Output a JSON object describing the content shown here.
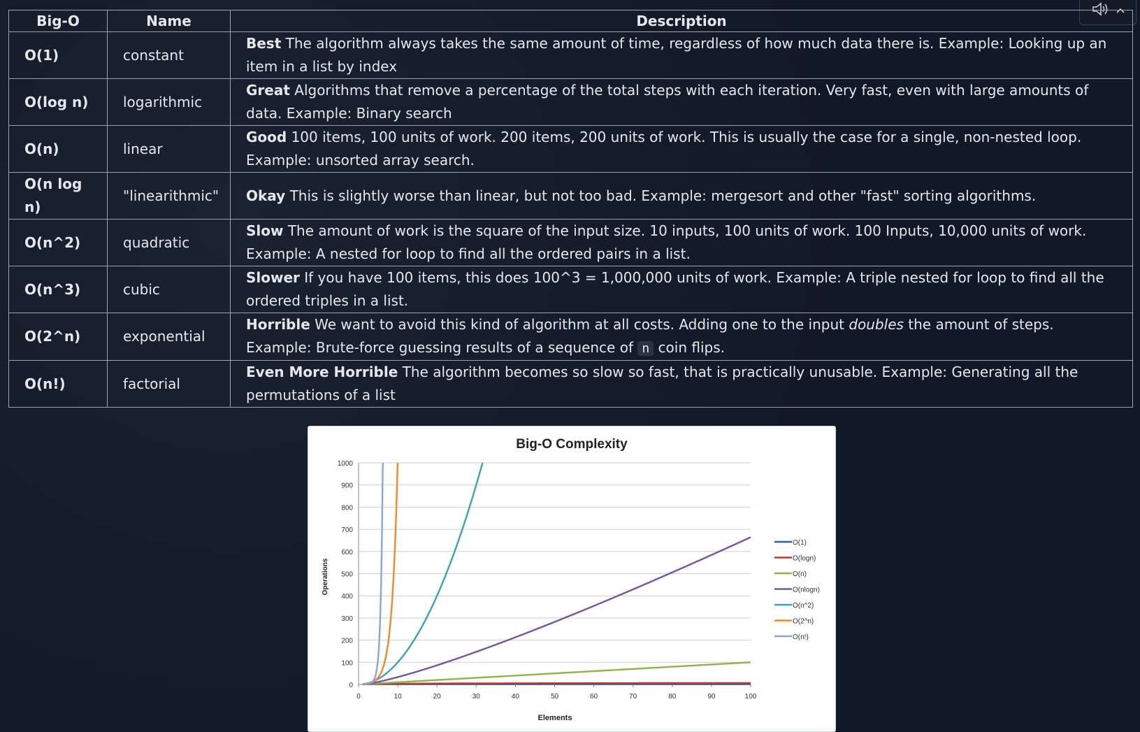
{
  "table": {
    "headers": [
      "Big-O",
      "Name",
      "Description"
    ],
    "rows": [
      {
        "bigo": "O(1)",
        "name": "constant",
        "label": "Best",
        "desc": " The algorithm always takes the same amount of time, regardless of how much data there is. Example: Looking up an item in a list by index"
      },
      {
        "bigo": "O(log n)",
        "name": "logarithmic",
        "label": "Great",
        "desc": " Algorithms that remove a percentage of the total steps with each iteration. Very fast, even with large amounts of data. Example: Binary search"
      },
      {
        "bigo": "O(n)",
        "name": "linear",
        "label": "Good",
        "desc": " 100 items, 100 units of work. 200 items, 200 units of work. This is usually the case for a single, non-nested loop. Example: unsorted array search."
      },
      {
        "bigo": "O(n log n)",
        "name": "\"linearithmic\"",
        "label": "Okay",
        "desc": " This is slightly worse than linear, but not too bad. Example: mergesort and other \"fast\" sorting algorithms."
      },
      {
        "bigo": "O(n^2)",
        "name": "quadratic",
        "label": "Slow",
        "desc": " The amount of work is the square of the input size. 10 inputs, 100 units of work. 100 Inputs, 10,000 units of work. Example: A nested for loop to find all the ordered pairs in a list."
      },
      {
        "bigo": "O(n^3)",
        "name": "cubic",
        "label": "Slower",
        "desc": " If you have 100 items, this does 100^3 = 1,000,000 units of work. Example: A triple nested for loop to find all the ordered triples in a list."
      },
      {
        "bigo": "O(2^n)",
        "name": "exponential",
        "label": "Horrible",
        "desc_a": " We want to avoid this kind of algorithm at all costs. Adding one to the input ",
        "desc_em": "doubles",
        "desc_b": " the amount of steps. Example: Brute-force guessing results of a sequence of ",
        "desc_code": "n",
        "desc_c": " coin flips."
      },
      {
        "bigo": "O(n!)",
        "name": "factorial",
        "label": "Even More Horrible",
        "desc": " The algorithm becomes so slow so fast, that is practically unusable. Example: Generating all the permutations of a list"
      }
    ]
  },
  "chart_data": {
    "type": "line",
    "title": "Big-O Complexity",
    "xlabel": "Elements",
    "ylabel": "Operations",
    "xlim": [
      0,
      100
    ],
    "ylim": [
      0,
      1000
    ],
    "x_ticks": [
      "0",
      "10",
      "20",
      "30",
      "40",
      "50",
      "60",
      "70",
      "80",
      "90",
      "100"
    ],
    "y_ticks": [
      "0",
      "100",
      "200",
      "300",
      "400",
      "500",
      "600",
      "700",
      "800",
      "900",
      "1000"
    ],
    "grid": "horizontal",
    "legend_position": "right",
    "series": [
      {
        "name": "O(1)",
        "color": "#2f5fa6",
        "x": [
          0,
          100
        ],
        "y": [
          1,
          1
        ]
      },
      {
        "name": "O(logn)",
        "color": "#c0392b",
        "x": [
          0,
          10,
          30,
          50,
          70,
          100
        ],
        "y": [
          0,
          3.3,
          4.9,
          5.6,
          6.1,
          6.6
        ]
      },
      {
        "name": "O(n)",
        "color": "#8ab64a",
        "x": [
          0,
          100
        ],
        "y": [
          0,
          100
        ]
      },
      {
        "name": "O(nlogn)",
        "color": "#7a55a3",
        "x": [
          0,
          10,
          20,
          40,
          60,
          80,
          100
        ],
        "y": [
          0,
          33,
          86,
          213,
          354,
          506,
          664
        ]
      },
      {
        "name": "O(n^2)",
        "color": "#3aa3b8",
        "x": [
          0,
          5,
          10,
          15,
          20,
          25,
          28,
          31.6
        ],
        "y": [
          0,
          25,
          100,
          225,
          400,
          625,
          784,
          1000
        ]
      },
      {
        "name": "O(2^n)",
        "color": "#f08a28",
        "x": [
          0,
          4,
          6,
          7,
          8,
          9,
          9.5,
          9.97
        ],
        "y": [
          1,
          16,
          64,
          128,
          256,
          512,
          724,
          1000
        ]
      },
      {
        "name": "O(n!)",
        "color": "#8aa6d9",
        "x": [
          0,
          3,
          4,
          5,
          6,
          6.3
        ],
        "y": [
          1,
          6,
          24,
          120,
          720,
          1000
        ]
      }
    ]
  }
}
